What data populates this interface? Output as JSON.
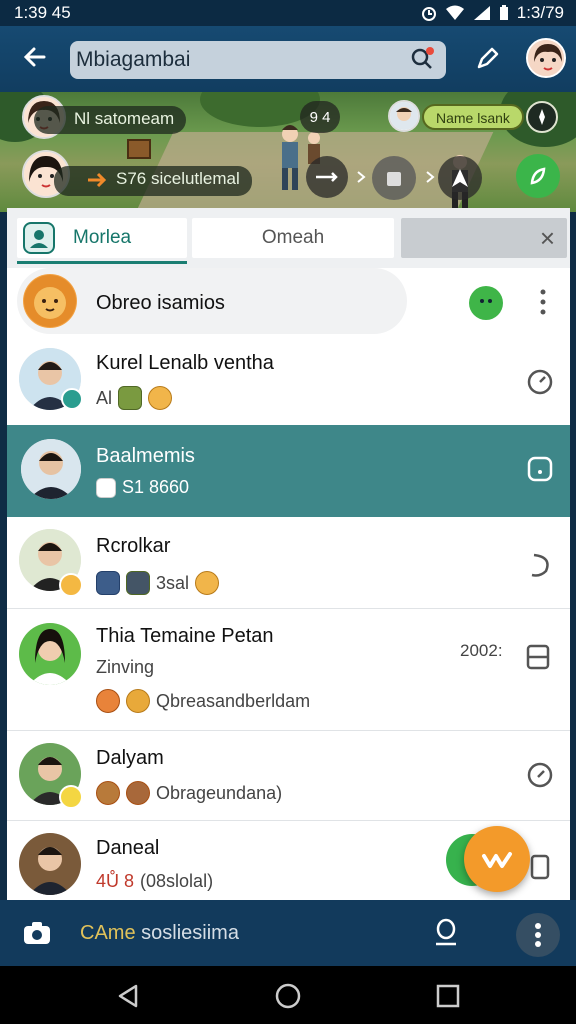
{
  "status_bar": {
    "time": "1:39 45",
    "battery_text": "1:3/79"
  },
  "app_bar": {
    "search_value": "Mbiagambai"
  },
  "game": {
    "chip1_text": "Nl satomeam",
    "chip2_text": "S76 sicelutlemal",
    "badge_text": "Name lsank",
    "bubble_text": "9 4"
  },
  "tabs": {
    "tab1": "Morlea",
    "tab2": "Omeah",
    "close_glyph": "×"
  },
  "chats": [
    {
      "name": "Obreo isamios"
    },
    {
      "name": "Kurel Lenalb ventha",
      "sub": "Al"
    },
    {
      "name": "Baalmemis",
      "sub": "S1 8660"
    },
    {
      "name": "Rcrolkar",
      "sub": "3sal"
    },
    {
      "name": "Thia Temaine Petan",
      "sub1": "Zinving",
      "sub2": "Qbreasandberldam",
      "meta": "2002:"
    },
    {
      "name": "Dalyam",
      "sub": "Obrageundana)"
    },
    {
      "name": "Daneal",
      "sub": "(08slolal)",
      "sub_red": "4Ů 8"
    }
  ],
  "bottom_bar": {
    "text_accent": "CAme",
    "text_rest": " sosliesiima"
  },
  "colors": {
    "teal": "#3e8789",
    "primary": "#164a72",
    "accent": "#f39a2a"
  }
}
